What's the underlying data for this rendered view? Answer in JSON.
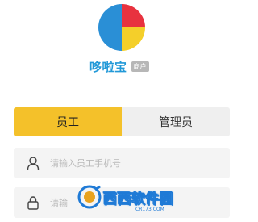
{
  "app": {
    "name": "哆啦宝",
    "badge": "商户"
  },
  "tabs": [
    {
      "label": "员工",
      "active": true
    },
    {
      "label": "管理员",
      "active": false
    }
  ],
  "form": {
    "phone_placeholder": "请输入员工手机号",
    "phone_value": "",
    "password_placeholder": "请输",
    "password_value": ""
  },
  "icons": {
    "logo": "pie-logo-icon",
    "phone": "user-icon",
    "password": "lock-icon"
  },
  "colors": {
    "accent": "#f4c12a",
    "brand_text": "#2299d8",
    "logo_blue": "#2a8fd6",
    "logo_red": "#e8323f",
    "logo_yellow": "#f4cf2a",
    "field_bg": "#f4f4f4"
  },
  "watermark": {
    "text": "西西软件园",
    "site": "CR173.COM"
  }
}
